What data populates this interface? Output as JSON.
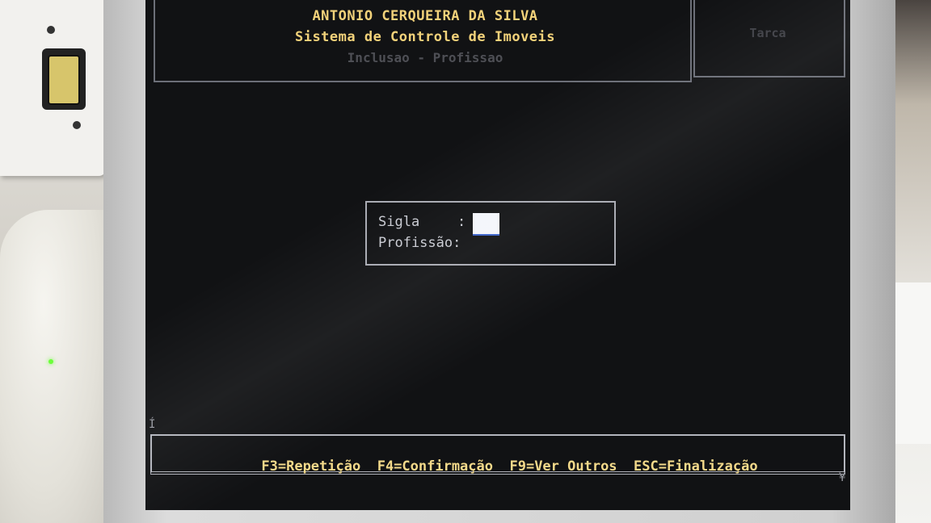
{
  "header": {
    "company": "ANTONIO CERQUEIRA DA SILVA",
    "system_title": "Sistema de Controle de Imoveis",
    "mode": "Inclusao - Profissao",
    "right_panel_text": "Tarca"
  },
  "form": {
    "sigla_label": "Sigla",
    "sigla_colon": ":",
    "sigla_value": "",
    "profissao_label": "Profissão:",
    "profissao_value": ""
  },
  "footer": {
    "keys": [
      {
        "label": "F3=Repetição"
      },
      {
        "label": "F4=Confirmação"
      },
      {
        "label": "F9=Ver Outros"
      },
      {
        "label": "ESC=Finalização"
      }
    ]
  },
  "colors": {
    "screen_bg": "#111214",
    "header_text": "#f2d27a",
    "footer_text": "#f3d98a",
    "form_text": "#c9cbd2",
    "cursor_field": "#f4f6fb"
  }
}
